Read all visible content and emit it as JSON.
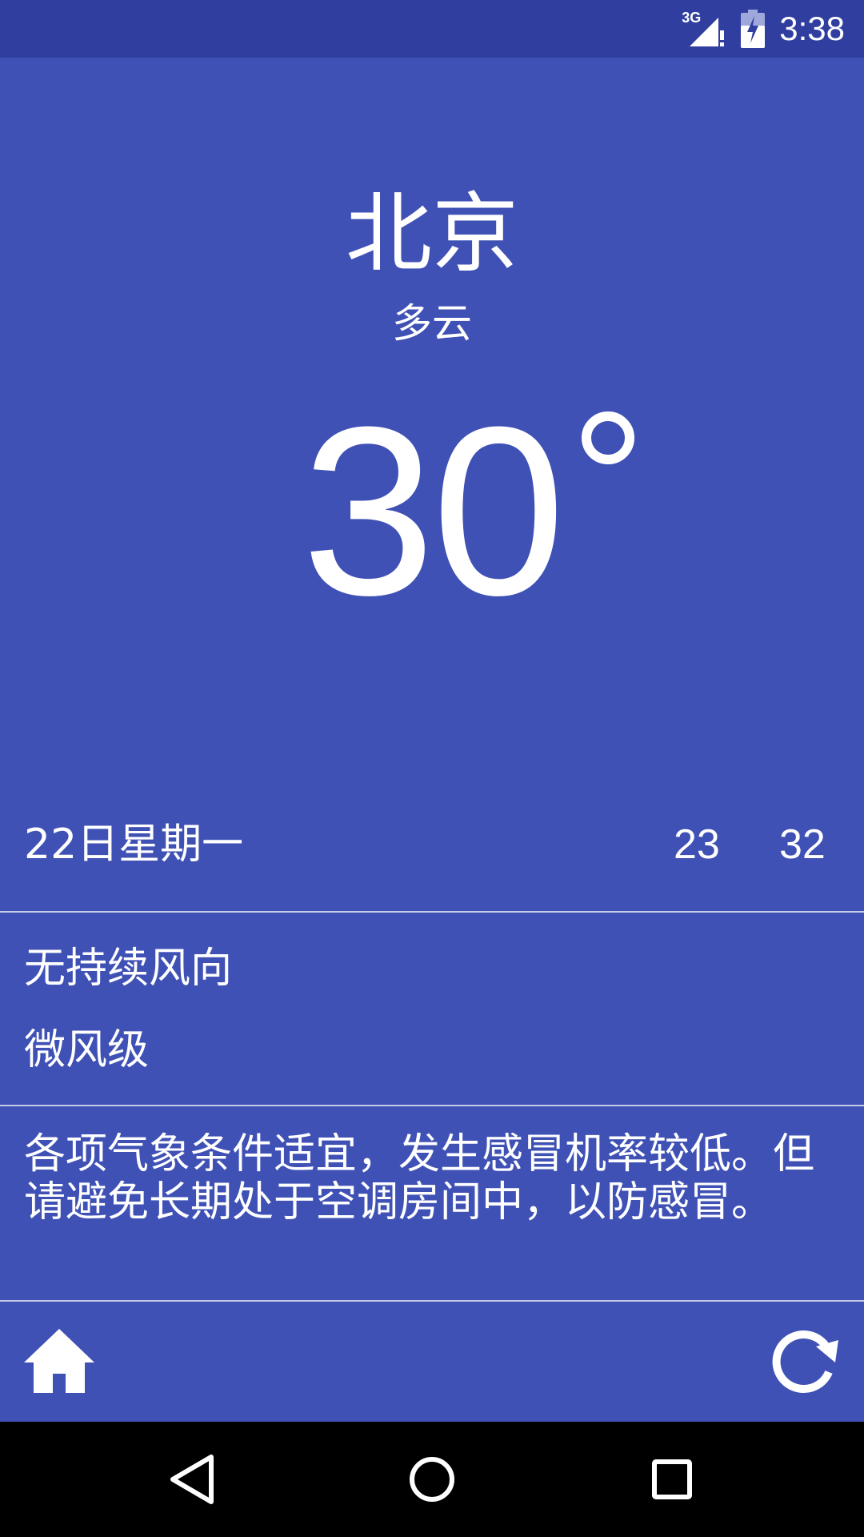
{
  "status_bar": {
    "network": "3G",
    "time": "3:38"
  },
  "weather": {
    "city": "北京",
    "condition": "多云",
    "temperature": "30"
  },
  "forecast": {
    "date": "22日星期一",
    "low": "23",
    "high": "32"
  },
  "wind": {
    "direction": "无持续风向",
    "level": "微风级"
  },
  "advice": "各项气象条件适宜，发生感冒机率较低。但请避免长期处于空调房间中，以防感冒。",
  "toolbar": {
    "home_icon": "home-icon",
    "refresh_icon": "refresh-icon"
  },
  "nav_bar": {
    "back_icon": "triangle-back-icon",
    "home_icon": "circle-home-icon",
    "recents_icon": "square-recents-icon"
  },
  "colors": {
    "primary": "#3f51b5",
    "primary_dark": "#303f9f",
    "text": "#ffffff"
  }
}
